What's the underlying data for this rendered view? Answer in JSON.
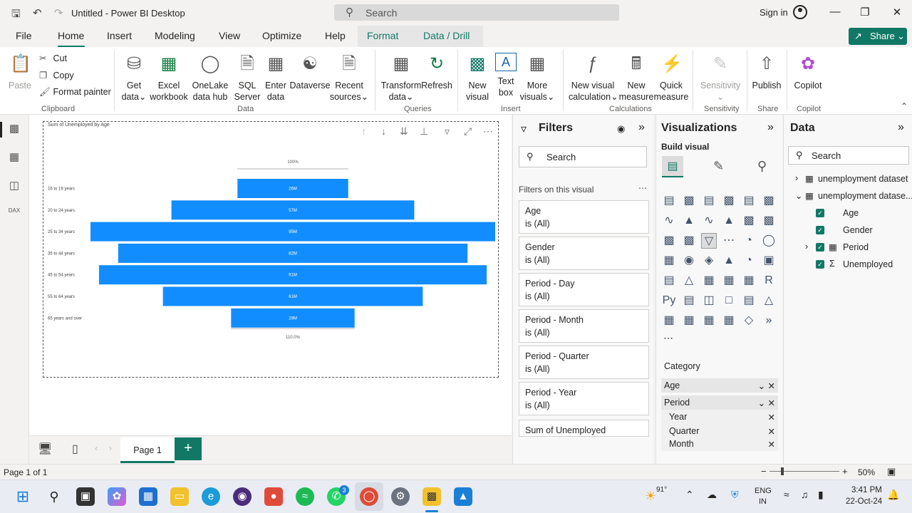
{
  "app": {
    "title": "Untitled - Power BI Desktop",
    "search_placeholder": "Search",
    "sign_in": "Sign in"
  },
  "tabs": [
    "File",
    "Home",
    "Insert",
    "Modeling",
    "View",
    "Optimize",
    "Help",
    "Format",
    "Data / Drill"
  ],
  "share_label": "Share",
  "ribbon": {
    "paste": "Paste",
    "cut": "Cut",
    "copy": "Copy",
    "format_painter": "Format painter",
    "clipboard": "Clipboard",
    "get_data": [
      "Get",
      "data"
    ],
    "excel": [
      "Excel",
      "workbook"
    ],
    "onelake": [
      "OneLake",
      "data hub"
    ],
    "sql": [
      "SQL",
      "Server"
    ],
    "enter_data": [
      "Enter",
      "data"
    ],
    "dataverse": "Dataverse",
    "recent": [
      "Recent",
      "sources"
    ],
    "data_group": "Data",
    "transform": [
      "Transform",
      "data"
    ],
    "refresh": "Refresh",
    "queries_group": "Queries",
    "new_visual": [
      "New",
      "visual"
    ],
    "text_box": [
      "Text",
      "box"
    ],
    "more_visuals": [
      "More",
      "visuals"
    ],
    "insert_group": "Insert",
    "new_visual_calc": [
      "New visual",
      "calculation"
    ],
    "new_measure": [
      "New",
      "measure"
    ],
    "quick_measure": [
      "Quick",
      "measure"
    ],
    "calculations_group": "Calculations",
    "sensitivity": "Sensitivity",
    "sensitivity_group": "Sensitivity",
    "publish": "Publish",
    "share_group": "Share",
    "copilot": "Copilot",
    "copilot_group": "Copilot"
  },
  "chart_data": {
    "type": "funnel",
    "title": "Sum of Unemployed by Age",
    "categories": [
      "16 to 19 years",
      "20 to 24 years",
      "25 to 34 years",
      "35 to 44 years",
      "45 to 54 years",
      "55 to 64 years",
      "65 years and over"
    ],
    "values": [
      26,
      57,
      95,
      82,
      91,
      61,
      29
    ],
    "value_labels": [
      "26M",
      "57M",
      "95M",
      "82M",
      "91M",
      "61M",
      "29M"
    ],
    "top_label": "100%",
    "bottom_label": "110.0%",
    "bar_color": "#118dff"
  },
  "page_tab": "Page 1",
  "filters": {
    "title": "Filters",
    "search": "Search",
    "section": "Filters on this visual",
    "cards": [
      {
        "name": "Age",
        "value": "is (All)"
      },
      {
        "name": "Gender",
        "value": "is (All)"
      },
      {
        "name": "Period - Day",
        "value": "is (All)"
      },
      {
        "name": "Period - Month",
        "value": "is (All)"
      },
      {
        "name": "Period - Quarter",
        "value": "is (All)"
      },
      {
        "name": "Period - Year",
        "value": "is (All)"
      },
      {
        "name": "Sum of Unemployed",
        "value": ""
      }
    ]
  },
  "viz": {
    "title": "Visualizations",
    "build": "Build visual",
    "category": "Category",
    "wells": [
      "Age",
      "Period",
      "Year",
      "Quarter",
      "Month"
    ]
  },
  "data": {
    "title": "Data",
    "search": "Search",
    "tables": [
      "unemployment dataset",
      "unemployment datase..."
    ],
    "fields": [
      "Age",
      "Gender",
      "Period",
      "Unemployed"
    ]
  },
  "status": {
    "page": "Page 1 of 1",
    "zoom": "50%"
  },
  "taskbar": {
    "weather": "91°",
    "lang1": "ENG",
    "lang2": "IN",
    "time": "3:41 PM",
    "date": "22-Oct-24",
    "whatsapp_badge": "3"
  }
}
